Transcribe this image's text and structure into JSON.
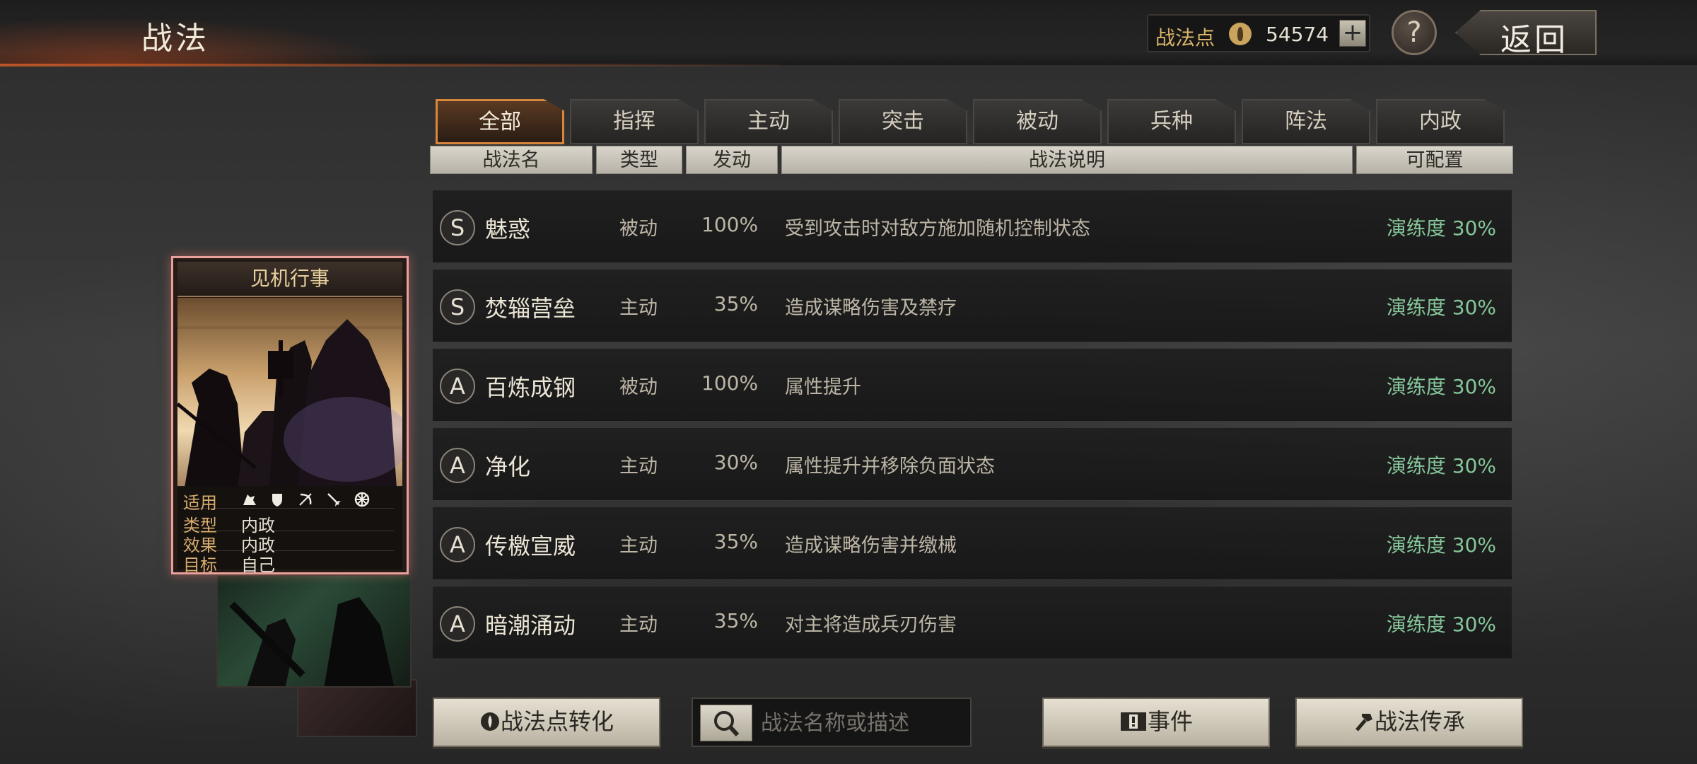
{
  "header": {
    "title": "战法",
    "points_label": "战法点",
    "points_value": "54574",
    "add_label": "+",
    "help_label": "?",
    "back_label": "返回"
  },
  "tabs": [
    {
      "label": "全部",
      "active": true
    },
    {
      "label": "指挥",
      "active": false
    },
    {
      "label": "主动",
      "active": false
    },
    {
      "label": "突击",
      "active": false
    },
    {
      "label": "被动",
      "active": false
    },
    {
      "label": "兵种",
      "active": false
    },
    {
      "label": "阵法",
      "active": false
    },
    {
      "label": "内政",
      "active": false
    }
  ],
  "columns": {
    "name": "战法名",
    "type": "类型",
    "rate": "发动",
    "desc": "战法说明",
    "config": "可配置"
  },
  "rows": [
    {
      "grade": "S",
      "name": "魅惑",
      "type": "被动",
      "rate": "100%",
      "desc": "受到攻击时对敌方施加随机控制状态",
      "config": "演练度 30%"
    },
    {
      "grade": "S",
      "name": "焚辎营垒",
      "type": "主动",
      "rate": "35%",
      "desc": "造成谋略伤害及禁疗",
      "config": "演练度 30%"
    },
    {
      "grade": "A",
      "name": "百炼成钢",
      "type": "被动",
      "rate": "100%",
      "desc": "属性提升",
      "config": "演练度 30%"
    },
    {
      "grade": "A",
      "name": "净化",
      "type": "主动",
      "rate": "30%",
      "desc": "属性提升并移除负面状态",
      "config": "演练度 30%"
    },
    {
      "grade": "A",
      "name": "传檄宣威",
      "type": "主动",
      "rate": "35%",
      "desc": "造成谋略伤害并缴械",
      "config": "演练度 30%"
    },
    {
      "grade": "A",
      "name": "暗潮涌动",
      "type": "主动",
      "rate": "35%",
      "desc": "对主将造成兵刃伤害",
      "config": "演练度 30%"
    }
  ],
  "card": {
    "title": "见机行事",
    "applies_label": "适用",
    "type_label": "类型",
    "type_value": "内政",
    "effect_label": "效果",
    "effect_value": "内政",
    "target_label": "目标",
    "target_value": "自己",
    "unit_icons": [
      "cavalry-icon",
      "shield-icon",
      "bow-icon",
      "spear-icon",
      "wheel-icon"
    ]
  },
  "bottom": {
    "convert_label": "战法点转化",
    "search_placeholder": "战法名称或描述",
    "event_label": "事件",
    "inherit_label": "战法传承"
  },
  "colors": {
    "accent": "#d9863d",
    "config_green": "#86c79a",
    "card_border": "#e9a09a"
  }
}
